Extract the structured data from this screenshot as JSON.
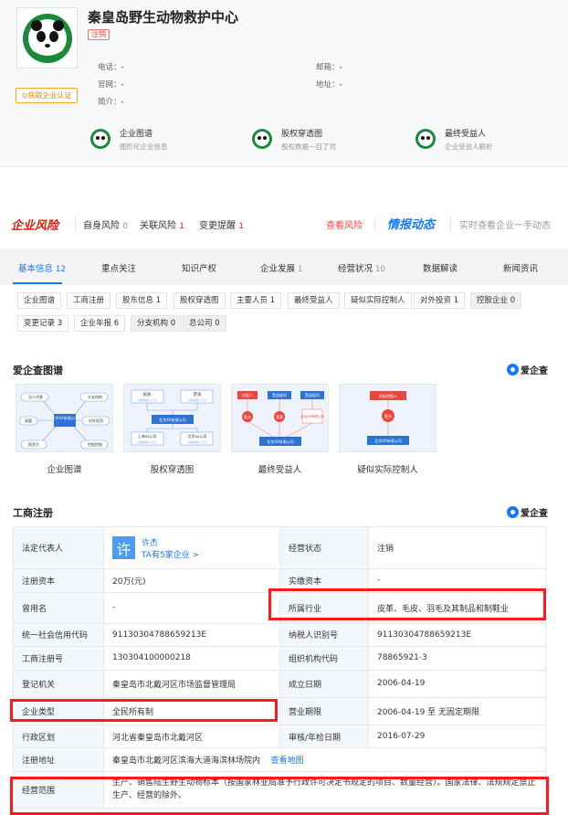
{
  "company": {
    "name": "秦皇岛野生动物救护中心",
    "status": "注销",
    "cert_button": "获取企业认证"
  },
  "contacts": {
    "phone_label": "电话：",
    "phone": "-",
    "email_label": "邮箱：",
    "email": "-",
    "website_label": "官网：",
    "website": "-",
    "address_label": "地址：",
    "address": "-",
    "intro_label": "简介：",
    "intro": "-"
  },
  "features": [
    {
      "title": "企业图谱",
      "sub": "图形化企业信息"
    },
    {
      "title": "股权穿透图",
      "sub": "股权数据一目了然"
    },
    {
      "title": "最终受益人",
      "sub": "企业受益人解析"
    }
  ],
  "risk": {
    "brand": "企业风险",
    "self": "自身风险",
    "self_n": "0",
    "related": "关联风险",
    "related_n": "1",
    "change": "变更提醒",
    "change_n": "1",
    "view": "查看风险",
    "news": "情报动态",
    "news_desc": "实时查看企业一手动态"
  },
  "tabs": [
    {
      "label": "基本信息",
      "n": "12"
    },
    {
      "label": "重点关注",
      "n": ""
    },
    {
      "label": "知识产权",
      "n": ""
    },
    {
      "label": "企业发展",
      "n": "1"
    },
    {
      "label": "经营状况",
      "n": "10"
    },
    {
      "label": "数据解读",
      "n": ""
    },
    {
      "label": "新闻资讯",
      "n": ""
    }
  ],
  "chips": [
    "企业图谱",
    "工商注册",
    "股东信息 1",
    "股权穿透图",
    "主要人员 1",
    "最终受益人",
    "疑似实际控制人",
    "对外投资 1",
    "控股企业 0",
    "变更记录 3",
    "企业年报 6",
    "分支机构 0",
    "总公司 0"
  ],
  "atlas": {
    "title": "爱企查图谱",
    "brand": "爱企查",
    "items": [
      "企业图谱",
      "股权穿透图",
      "最终受益人",
      "疑似实际控制人"
    ],
    "g1": {
      "rep": "法人代表",
      "branch": "分支机构",
      "exec": "高管",
      "invest_out": "对外投资",
      "investor": "投资方",
      "holding": "控股控股",
      "center": "北京XX有限公司"
    },
    "g2": {
      "p1": "张总",
      "p2": "李总",
      "sub1": "认缴金额xx万元",
      "sub2": "认缴金额xx万元",
      "center": "北京XX有限公司",
      "c1": "上海xx公司",
      "c2": "北京xx公司"
    },
    "g3": {
      "a": "控股人",
      "b": "受益股份",
      "c": "受益股份",
      "n1": "股东",
      "n2": "董事",
      "n3": "北京XX有限公司",
      "bottom": "北京XX有限公司"
    },
    "g4": {
      "top": "实际控制人",
      "mid": "股东",
      "bottom": "北京XX有限公司"
    }
  },
  "registration": {
    "title": "工商注册",
    "brand": "爱企查",
    "legal_rep_label": "法定代表人",
    "legal_rep_avatar": "许",
    "legal_rep": "许杰",
    "legal_rep_sub": "TA有5家企业 >",
    "status_label": "经营状态",
    "status": "注销",
    "capital_label": "注册资本",
    "capital": "20万(元)",
    "paid_label": "实缴资本",
    "paid": "-",
    "former_label": "曾用名",
    "former": "-",
    "industry_label": "所属行业",
    "industry": "皮革、毛皮、羽毛及其制品和制鞋业",
    "credit_label": "统一社会信用代码",
    "credit": "91130304788659213E",
    "taxid_label": "纳税人识别号",
    "taxid": "91130304788659213E",
    "regno_label": "工商注册号",
    "regno": "130304100000218",
    "orgcode_label": "组织机构代码",
    "orgcode": "78865921-3",
    "authority_label": "登记机关",
    "authority": "秦皇岛市北戴河区市场监督管理局",
    "founded_label": "成立日期",
    "founded": "2006-04-19",
    "type_label": "企业类型",
    "type": "全民所有制",
    "term_label": "营业期限",
    "term": "2006-04-19 至 无固定期限",
    "region_label": "行政区划",
    "region": "河北省秦皇岛市北戴河区",
    "check_label": "审核/年检日期",
    "check": "2016-07-29",
    "addr_label": "注册地址",
    "addr": "秦皇岛市北戴河区滨海大道海滨林场院内",
    "map_link": "查看地图",
    "scope_label": "经营范围",
    "scope": "生产、销售陆生野生动物标本（按国家林业局准予行政许可决定书规定的项目、数量经营）。国家法律、法规规定禁止生产、经营的除外。"
  },
  "colors": {
    "accent": "#1677ff",
    "risk": "#d81e06",
    "highlight": "#ff1a1a"
  }
}
